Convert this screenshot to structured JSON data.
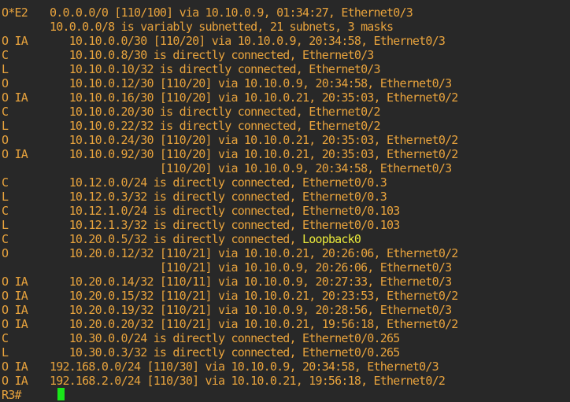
{
  "terminal": {
    "lines": [
      {
        "code": "O*E2",
        "text": "0.0.0.0/0 [110/100] via 10.10.0.9, 01:34:27, Ethernet0/3"
      },
      {
        "code": "",
        "text": "10.0.0.0/8 is variably subnetted, 21 subnets, 3 masks"
      },
      {
        "code": "O IA",
        "text": "   10.10.0.0/30 [110/20] via 10.10.0.9, 20:34:58, Ethernet0/3"
      },
      {
        "code": "C",
        "text": "   10.10.0.8/30 is directly connected, Ethernet0/3"
      },
      {
        "code": "L",
        "text": "   10.10.0.10/32 is directly connected, Ethernet0/3"
      },
      {
        "code": "O",
        "text": "   10.10.0.12/30 [110/20] via 10.10.0.9, 20:34:58, Ethernet0/3"
      },
      {
        "code": "O IA",
        "text": "   10.10.0.16/30 [110/20] via 10.10.0.21, 20:35:03, Ethernet0/2"
      },
      {
        "code": "C",
        "text": "   10.10.0.20/30 is directly connected, Ethernet0/2"
      },
      {
        "code": "L",
        "text": "   10.10.0.22/32 is directly connected, Ethernet0/2"
      },
      {
        "code": "O",
        "text": "   10.10.0.24/30 [110/20] via 10.10.0.21, 20:35:03, Ethernet0/2"
      },
      {
        "code": "O IA",
        "text": "   10.10.0.92/30 [110/20] via 10.10.0.21, 20:35:03, Ethernet0/2"
      },
      {
        "code": "",
        "text": "                 [110/20] via 10.10.0.9, 20:34:58, Ethernet0/3"
      },
      {
        "code": "C",
        "text": "   10.12.0.0/24 is directly connected, Ethernet0/0.3"
      },
      {
        "code": "L",
        "text": "   10.12.0.3/32 is directly connected, Ethernet0/0.3"
      },
      {
        "code": "C",
        "text": "   10.12.1.0/24 is directly connected, Ethernet0/0.103"
      },
      {
        "code": "L",
        "text": "   10.12.1.3/32 is directly connected, Ethernet0/0.103"
      },
      {
        "code": "C",
        "text": "   10.20.0.5/32 is directly connected, ",
        "highlight": "Loopback0"
      },
      {
        "code": "O",
        "text": "   10.20.0.12/32 [110/21] via 10.10.0.21, 20:26:06, Ethernet0/2"
      },
      {
        "code": "",
        "text": "                 [110/21] via 10.10.0.9, 20:26:06, Ethernet0/3"
      },
      {
        "code": "O IA",
        "text": "   10.20.0.14/32 [110/11] via 10.10.0.9, 20:27:33, Ethernet0/3"
      },
      {
        "code": "O IA",
        "text": "   10.20.0.15/32 [110/21] via 10.10.0.21, 20:23:53, Ethernet0/2"
      },
      {
        "code": "O IA",
        "text": "   10.20.0.19/32 [110/21] via 10.10.0.9, 20:28:56, Ethernet0/3"
      },
      {
        "code": "O IA",
        "text": "   10.20.0.20/32 [110/21] via 10.10.0.21, 19:56:18, Ethernet0/2"
      },
      {
        "code": "C",
        "text": "   10.30.0.0/24 is directly connected, Ethernet0/0.265"
      },
      {
        "code": "L",
        "text": "   10.30.0.3/32 is directly connected, Ethernet0/0.265"
      },
      {
        "code": "O IA",
        "text": "192.168.0.0/24 [110/30] via 10.10.0.9, 20:34:58, Ethernet0/3"
      },
      {
        "code": "O IA",
        "text": "192.168.2.0/24 [110/30] via 10.10.0.21, 19:56:18, Ethernet0/2"
      }
    ],
    "prompt": "R3#",
    "colors": {
      "background": "#282828",
      "text": "#e8a33d",
      "highlight": "#e8e83a",
      "cursor": "#19e619"
    }
  }
}
